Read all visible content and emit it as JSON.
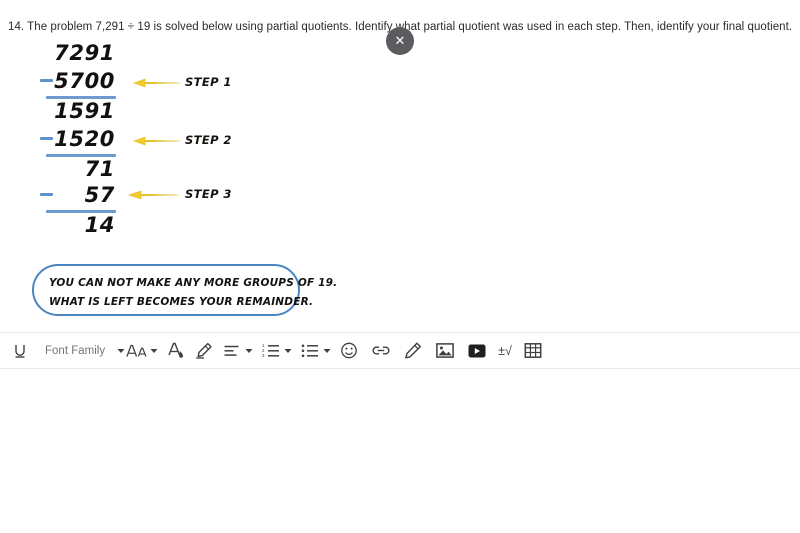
{
  "question": {
    "text": "14. The problem 7,291 ÷ 19 is solved below using partial quotients. Identify what partial quotient was used in each step. Then, identify your final quotient."
  },
  "close_button": {
    "icon": "close-icon",
    "glyph": "✕"
  },
  "worksheet": {
    "accent_blue": "#5f92c9",
    "arrow_yellow": "#f5d03a",
    "ink_black": "#13100f",
    "rows": [
      {
        "value": "7291",
        "minus": false
      },
      {
        "value": "5700",
        "minus": true
      },
      {
        "value": "1591",
        "minus": false
      },
      {
        "value": "1520",
        "minus": true
      },
      {
        "value": "71",
        "minus": false
      },
      {
        "value": "57",
        "minus": true
      },
      {
        "value": "14",
        "minus": false
      }
    ],
    "steps": [
      {
        "label": "STEP 1"
      },
      {
        "label": "STEP 2"
      },
      {
        "label": "STEP 3"
      }
    ],
    "callout": {
      "border_color": "#4a86c0",
      "line1": "YOU CAN NOT MAKE ANY MORE GROUPS OF 19.",
      "line2": "WHAT IS LEFT BECOMES YOUR REMAINDER."
    }
  },
  "toolbar": {
    "underline_label": "U",
    "font_family_label": "Font Family",
    "items": [
      {
        "name": "underline-button",
        "icon": "underline-icon"
      },
      {
        "name": "font-family-select",
        "icon": "font-family-dropdown"
      },
      {
        "name": "font-size-button",
        "icon": "font-size-icon"
      },
      {
        "name": "text-color-button",
        "icon": "text-color-icon"
      },
      {
        "name": "highlighter-button",
        "icon": "highlighter-icon"
      },
      {
        "name": "align-button",
        "icon": "align-left-icon"
      },
      {
        "name": "numbered-list-button",
        "icon": "numbered-list-icon"
      },
      {
        "name": "bulleted-list-button",
        "icon": "bulleted-list-icon"
      },
      {
        "name": "emoji-button",
        "icon": "emoji-icon"
      },
      {
        "name": "link-button",
        "icon": "link-icon"
      },
      {
        "name": "draw-button",
        "icon": "pencil-icon"
      },
      {
        "name": "insert-image-button",
        "icon": "image-icon"
      },
      {
        "name": "insert-video-button",
        "icon": "video-icon"
      },
      {
        "name": "equation-button",
        "icon": "equation-icon",
        "glyph": "±√"
      },
      {
        "name": "insert-table-button",
        "icon": "table-icon"
      }
    ]
  }
}
